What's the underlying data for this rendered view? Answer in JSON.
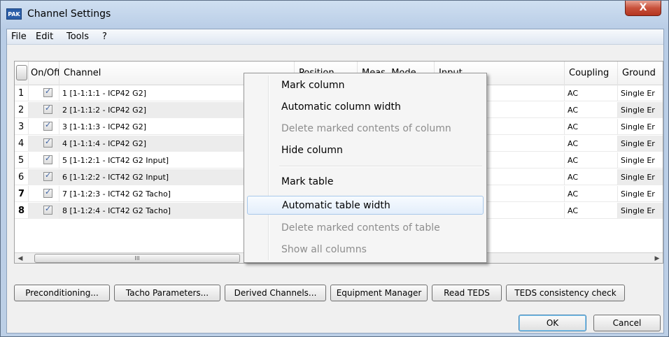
{
  "window": {
    "icon_text": "PAK",
    "title": "Channel Settings",
    "close_label": "X"
  },
  "menu": {
    "file": "File",
    "edit": "Edit",
    "tools": "Tools",
    "help": "?"
  },
  "table": {
    "headers": {
      "onoff": "On/Off",
      "channel": "Channel",
      "position": "Position",
      "meas_mode": "Meas. Mode",
      "input": "Input",
      "coupling": "Coupling",
      "ground": "Ground"
    },
    "rows": [
      {
        "num": "1",
        "checked": true,
        "channel": "1 [1-1:1:1 - ICP42 G2]",
        "coupling": "AC",
        "ground": "Single Er"
      },
      {
        "num": "2",
        "checked": true,
        "channel": "2 [1-1:1:2 - ICP42 G2]",
        "coupling": "AC",
        "ground": "Single Er"
      },
      {
        "num": "3",
        "checked": true,
        "channel": "3 [1-1:1:3 - ICP42 G2]",
        "coupling": "AC",
        "ground": "Single Er"
      },
      {
        "num": "4",
        "checked": true,
        "channel": "4 [1-1:1:4 - ICP42 G2]",
        "coupling": "AC",
        "ground": "Single Er"
      },
      {
        "num": "5",
        "checked": true,
        "channel": "5 [1-1:2:1 - ICT42 G2 Input]",
        "coupling": "AC",
        "ground": "Single Er"
      },
      {
        "num": "6",
        "checked": true,
        "channel": "6 [1-1:2:2 - ICT42 G2 Input]",
        "coupling": "AC",
        "ground": "Single Er"
      },
      {
        "num": "7",
        "checked": true,
        "channel": "7 [1-1:2:3 - ICT42 G2 Tacho]",
        "coupling": "AC",
        "ground": "Single Er"
      },
      {
        "num": "8",
        "checked": true,
        "channel": "8 [1-1:2:4 - ICT42 G2 Tacho]",
        "coupling": "AC",
        "ground": "Single Er"
      }
    ],
    "scroll_thumb": "III"
  },
  "buttons": {
    "preconditioning": "Preconditioning...",
    "tacho": "Tacho Parameters...",
    "derived": "Derived Channels...",
    "equipment": "Equipment Manager",
    "read_teds": "Read TEDS",
    "teds_check": "TEDS consistency check",
    "ok": "OK",
    "cancel": "Cancel"
  },
  "context_menu": {
    "mark_column": "Mark column",
    "auto_col_width": "Automatic column width",
    "delete_col": "Delete marked contents of column",
    "hide_column": "Hide column",
    "mark_table": "Mark table",
    "auto_table_width": "Automatic table width",
    "delete_table": "Delete marked contents of table",
    "show_all": "Show all columns"
  }
}
